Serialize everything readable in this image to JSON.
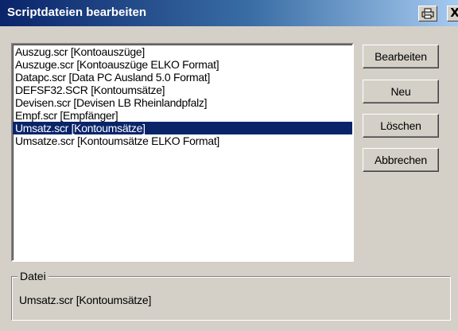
{
  "window": {
    "title": "Scriptdateien bearbeiten",
    "print_icon": "printer-icon",
    "close_label": "X"
  },
  "list": {
    "items": [
      "Auszug.scr [Kontoauszüge]",
      "Auszuge.scr [Kontoauszüge ELKO Format]",
      "Datapc.scr [Data PC Ausland 5.0 Format]",
      "DEFSF32.SCR [Kontoumsätze]",
      "Devisen.scr [Devisen LB Rheinlandpfalz]",
      "Empf.scr [Empfänger]",
      "Umsatz.scr [Kontoumsätze]",
      "Umsatze.scr [Kontoumsätze ELKO Format]"
    ],
    "selected": "Umsatz.scr [Kontoumsätze]"
  },
  "buttons": {
    "edit": "Bearbeiten",
    "new": "Neu",
    "delete": "Löschen",
    "cancel": "Abbrechen"
  },
  "file_group": {
    "label": "Datei",
    "value": "Umsatz.scr [Kontoumsätze]"
  },
  "colors": {
    "title_start": "#0a246a",
    "title_end": "#a6caf0",
    "selection": "#0a246a",
    "face": "#d4d0c8"
  }
}
